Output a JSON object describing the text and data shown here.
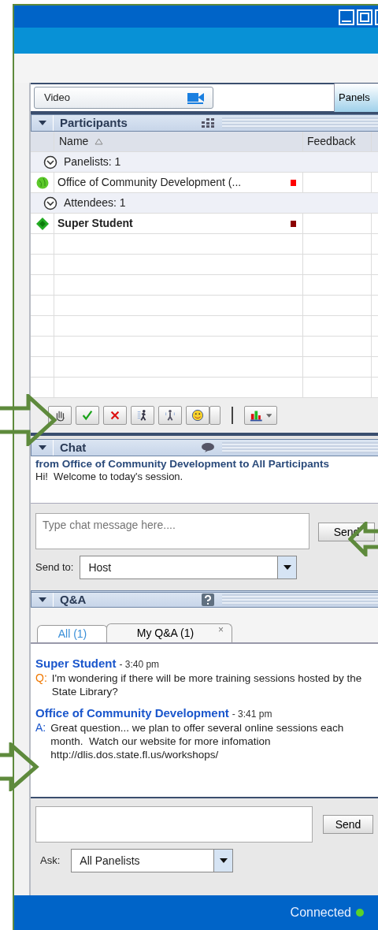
{
  "video_field": {
    "value": "Video"
  },
  "panels_button": "Panels",
  "participants": {
    "title": "Participants",
    "columns": [
      "Name",
      "Feedback"
    ],
    "groups": [
      {
        "label": "Panelists: 1",
        "expanded": true,
        "members": [
          {
            "name": "Office of Community Development (...",
            "kind": "panelist",
            "bold": false,
            "color": "#ff0000"
          }
        ]
      },
      {
        "label": "Attendees: 1",
        "expanded": true,
        "members": [
          {
            "name": "Super Student",
            "kind": "attendee",
            "bold": true,
            "color": "#8b0000"
          }
        ]
      }
    ]
  },
  "chat": {
    "title": "Chat",
    "messages": [
      {
        "from": "from Office of Community Development to All Participants",
        "text": "Hi!  Welcome to today's session."
      }
    ],
    "input": {
      "placeholder": "Type chat message here...."
    },
    "send_button": "Send",
    "send_to": {
      "label": "Send to:",
      "value": "Host"
    }
  },
  "qa": {
    "title": "Q&A",
    "tabs": [
      {
        "label": "All (1)",
        "selected": true
      },
      {
        "label": "My Q&A (1)",
        "selected": false,
        "close_label": "×"
      }
    ],
    "entries": [
      {
        "author": "Super Student",
        "time": "- 3:40 pm",
        "kind": "question",
        "marker": "Q:",
        "text": "I'm wondering if there will be more training sessions hosted by the State Library?"
      },
      {
        "author": "Office of Community Development",
        "time": "- 3:41 pm",
        "kind": "answer",
        "marker": "A:",
        "text": "Great question... we plan to offer several online sessions each month.  Watch our website for more infomation http://dlis.dos.state.fl.us/workshops/"
      }
    ],
    "send_button": "Send",
    "ask": {
      "label": "Ask:",
      "value": "All Panelists"
    }
  },
  "status": {
    "text": "Connected",
    "online": true
  }
}
